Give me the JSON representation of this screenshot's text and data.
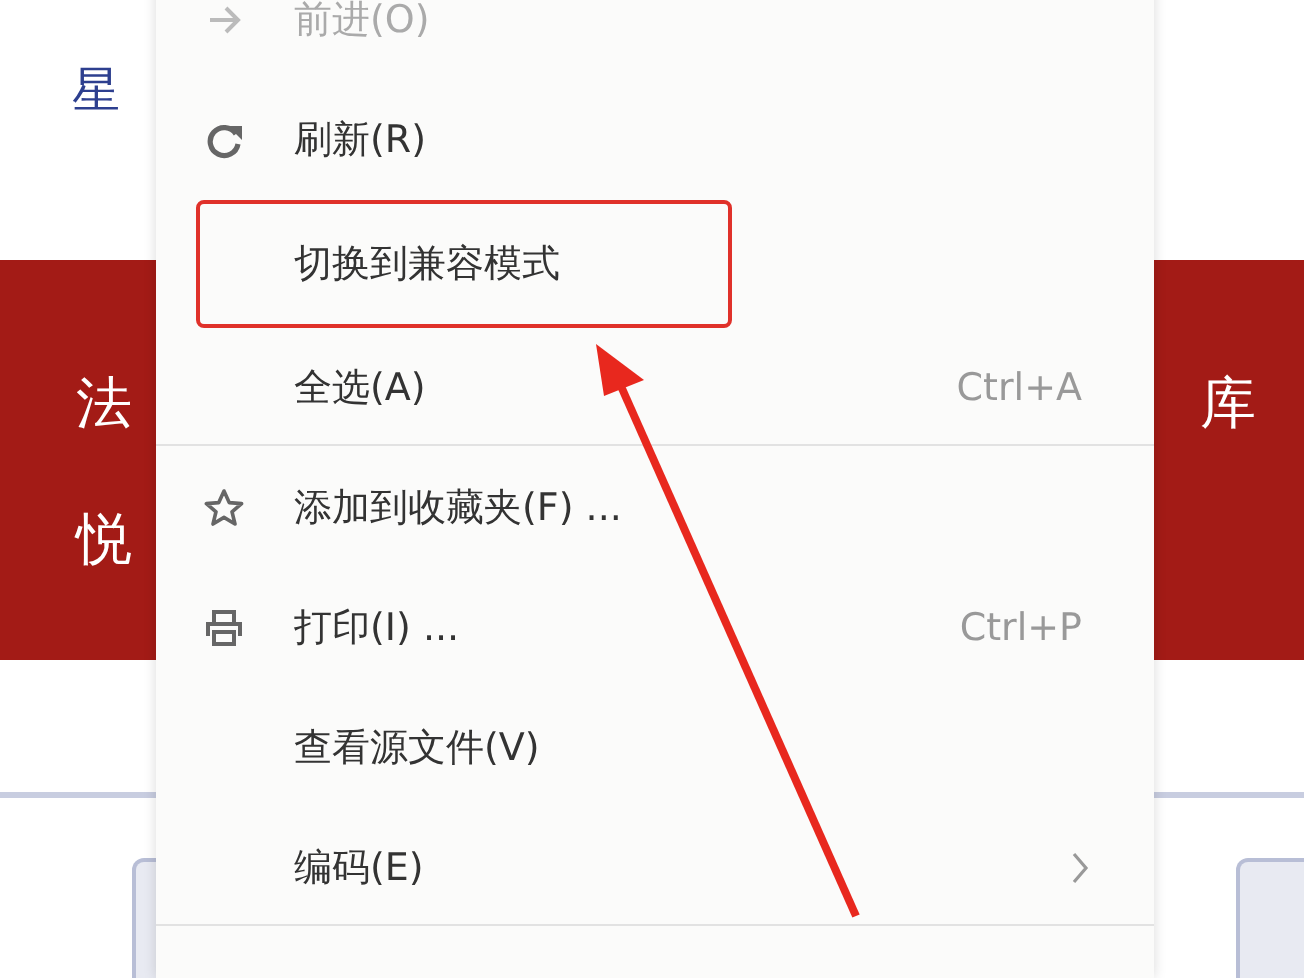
{
  "page": {
    "top_links": [
      "星"
    ],
    "banner_left": [
      "法",
      "悦"
    ],
    "banner_right": [
      "库"
    ]
  },
  "context_menu": {
    "items": [
      {
        "kind": "command",
        "label": "前进(O)",
        "disabled": true,
        "highlighted": false
      },
      {
        "kind": "command",
        "label": "刷新(R)",
        "disabled": false,
        "highlighted": false
      },
      {
        "kind": "command",
        "label": "切换到兼容模式",
        "disabled": false,
        "highlighted": true
      },
      {
        "kind": "command",
        "label": "全选(A)",
        "shortcut": "Ctrl+A",
        "disabled": false,
        "highlighted": false
      },
      {
        "kind": "separator"
      },
      {
        "kind": "command",
        "label": "添加到收藏夹(F) ...",
        "disabled": false,
        "highlighted": false
      },
      {
        "kind": "command",
        "label": "打印(I) ...",
        "shortcut": "Ctrl+P",
        "disabled": false,
        "highlighted": false
      },
      {
        "kind": "command",
        "label": "查看源文件(V)",
        "disabled": false,
        "highlighted": false
      },
      {
        "kind": "submenu",
        "label": "编码(E)",
        "disabled": false,
        "highlighted": false
      },
      {
        "kind": "separator"
      }
    ]
  }
}
